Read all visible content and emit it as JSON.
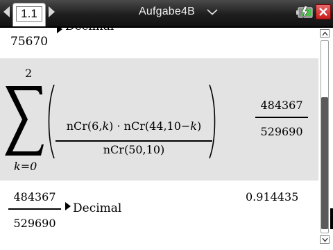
{
  "header": {
    "page_tab": "1.1",
    "document_title": "Aufgabe4B",
    "icons": [
      "nav-left-icon",
      "nav-right-icon",
      "chevron-down-icon",
      "battery-icon",
      "close-icon"
    ],
    "colors": {
      "titlebar": "#1e1e1e",
      "close_button": "#d42a2a",
      "selected_entry": "#e3e3e3"
    }
  },
  "history": {
    "partial_entry": {
      "command": "Decimal",
      "denominator": "75670"
    },
    "sum_entry": {
      "upper_limit": "2",
      "lower_limit": "k=0",
      "numerator_part1": "nCr(6,",
      "numerator_var1": "k",
      "numerator_part2": ") · nCr(44,10−",
      "numerator_var2": "k",
      "numerator_part3": ")",
      "denominator": "nCr(50,10)",
      "result_numerator": "484367",
      "result_denominator": "529690"
    },
    "decimal_entry": {
      "input_numerator": "484367",
      "input_denominator": "529690",
      "command": "Decimal",
      "result": "0.914435"
    }
  }
}
